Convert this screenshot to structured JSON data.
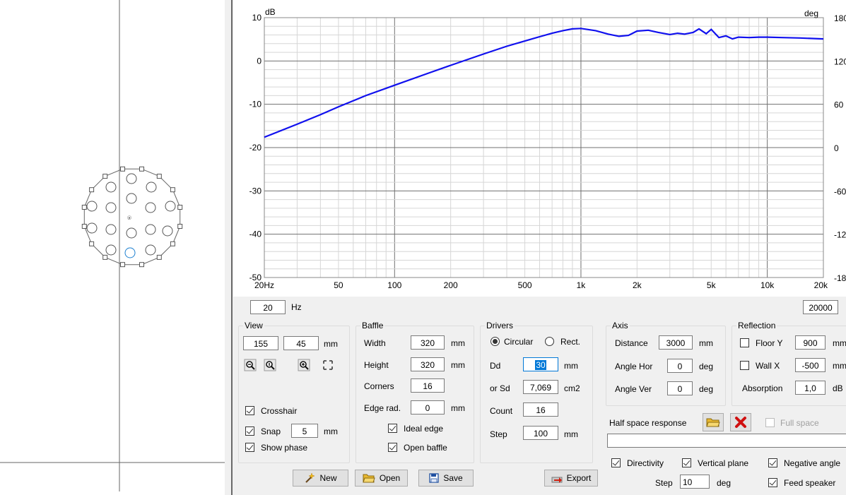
{
  "plot": {
    "y_unit": "dB",
    "y2_unit": "deg",
    "y_ticks": [
      "10",
      "0",
      "-10",
      "-20",
      "-30",
      "-40",
      "-50"
    ],
    "y2_ticks": [
      "180",
      "120",
      "60",
      "0",
      "-60",
      "-120",
      "-180"
    ],
    "x_ticks": [
      "20Hz",
      "50",
      "100",
      "200",
      "500",
      "1k",
      "2k",
      "5k",
      "10k",
      "20k"
    ]
  },
  "chart_data": {
    "type": "line",
    "x_scale": "log",
    "xlim": [
      20,
      20000
    ],
    "ylim": [
      -50,
      10
    ],
    "y2lim": [
      -180,
      180
    ],
    "grid": true,
    "series": [
      {
        "color": "#1010ee",
        "x": [
          20,
          30,
          40,
          50,
          70,
          100,
          150,
          200,
          300,
          400,
          500,
          600,
          700,
          800,
          900,
          1000,
          1200,
          1400,
          1600,
          1800,
          2000,
          2300,
          2600,
          3000,
          3300,
          3600,
          4000,
          4300,
          4700,
          5000,
          5500,
          6000,
          6500,
          7000,
          8000,
          9000,
          10000,
          12000,
          15000,
          17000,
          20000
        ],
        "y": [
          -17.6,
          -14.6,
          -12.4,
          -10.6,
          -8.0,
          -5.6,
          -2.9,
          -1.0,
          1.6,
          3.4,
          4.6,
          5.6,
          6.4,
          7.0,
          7.4,
          7.5,
          7.0,
          6.2,
          5.7,
          5.9,
          6.9,
          7.1,
          6.6,
          6.1,
          6.4,
          6.2,
          6.6,
          7.4,
          6.3,
          7.3,
          5.4,
          5.8,
          5.1,
          5.5,
          5.4,
          5.5,
          5.5,
          5.4,
          5.3,
          5.2,
          5.1
        ]
      }
    ]
  },
  "freq_min": "20",
  "freq_unit": "Hz",
  "freq_max": "20000",
  "view": {
    "title": "View",
    "x": "155",
    "y": "45",
    "unit": "mm",
    "crosshair_label": "Crosshair",
    "crosshair_checked": true,
    "snap_label": "Snap",
    "snap_checked": true,
    "snap_value": "5",
    "snap_unit": "mm",
    "show_phase_label": "Show phase",
    "show_phase_checked": true
  },
  "baffle": {
    "title": "Baffle",
    "width_label": "Width",
    "width": "320",
    "width_unit": "mm",
    "height_label": "Height",
    "height": "320",
    "height_unit": "mm",
    "corners_label": "Corners",
    "corners": "16",
    "edge_label": "Edge rad.",
    "edge": "0",
    "edge_unit": "mm",
    "ideal_edge_label": "Ideal edge",
    "open_baffle_label": "Open baffle"
  },
  "drivers": {
    "title": "Drivers",
    "circular_label": "Circular",
    "rect_label": "Rect.",
    "dd_label": "Dd",
    "dd": "30",
    "dd_unit": "mm",
    "sd_label": "or Sd",
    "sd": "7,069",
    "sd_unit": "cm2",
    "count_label": "Count",
    "count": "16",
    "step_label": "Step",
    "step": "100",
    "step_unit": "mm"
  },
  "axis": {
    "title": "Axis",
    "distance_label": "Distance",
    "distance": "3000",
    "distance_unit": "mm",
    "angle_hor_label": "Angle Hor",
    "angle_hor": "0",
    "angle_hor_unit": "deg",
    "angle_ver_label": "Angle Ver",
    "angle_ver": "0",
    "angle_ver_unit": "deg"
  },
  "reflection": {
    "title": "Reflection",
    "floor_label": "Floor Y",
    "floor": "900",
    "floor_unit": "mm",
    "wall_label": "Wall  X",
    "wall": "-500",
    "wall_unit": "mm",
    "absorption_label": "Absorption",
    "absorption": "1,0",
    "absorption_unit": "dB"
  },
  "half_space_label": "Half space response",
  "full_space_label": "Full space",
  "half_space_file": "",
  "directivity_label": "Directivity",
  "vertical_plane_label": "Vertical plane",
  "negative_angles_label": "Negative angle",
  "step2_label": "Step",
  "step2": "10",
  "step2_unit": "deg",
  "feed_speaker_label": "Feed speaker",
  "buttons": {
    "new": "New",
    "open": "Open",
    "save": "Save",
    "export": "Export"
  },
  "colors": {
    "curve": "#1010ee",
    "selected_driver": "#1c7fd0",
    "delete": "#d01010",
    "folder": "#e8b830"
  }
}
